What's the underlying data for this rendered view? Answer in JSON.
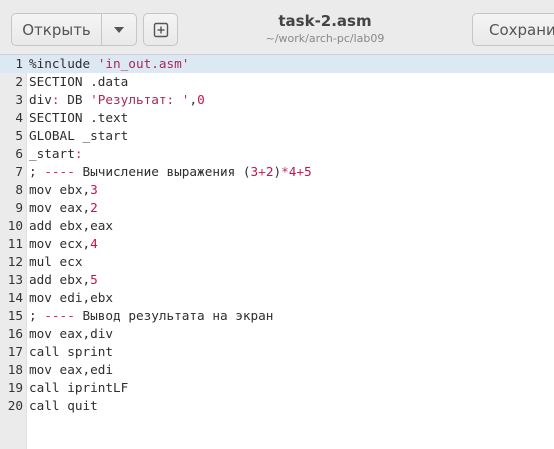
{
  "header": {
    "open_label": "Открыть",
    "title": "task-2.asm",
    "subtitle": "~/work/arch-pc/lab09",
    "save_label": "Сохранить"
  },
  "icons": {
    "open_menu": "chevron-down-icon",
    "new_tab": "new-document-icon"
  },
  "colors": {
    "string": "#a52a54",
    "number": "#c0174a",
    "operator": "#d2245a",
    "current_line": "#dde8f5"
  },
  "editor": {
    "current_line": 1,
    "lines": [
      [
        {
          "t": "%include ",
          "c": "kw"
        },
        {
          "t": "'in_out.asm'",
          "c": "str"
        }
      ],
      [
        {
          "t": "SECTION .data",
          "c": "kw"
        }
      ],
      [
        {
          "t": "div",
          "c": "kw"
        },
        {
          "t": ":",
          "c": "red"
        },
        {
          "t": " DB ",
          "c": "kw"
        },
        {
          "t": "'Результат: '",
          "c": "str"
        },
        {
          "t": ",",
          "c": "kw"
        },
        {
          "t": "0",
          "c": "num"
        }
      ],
      [
        {
          "t": "SECTION .text",
          "c": "kw"
        }
      ],
      [
        {
          "t": "GLOBAL _start",
          "c": "kw"
        }
      ],
      [
        {
          "t": "_start",
          "c": "kw"
        },
        {
          "t": ":",
          "c": "red"
        }
      ],
      [
        {
          "t": "; ",
          "c": "kw"
        },
        {
          "t": "----",
          "c": "red"
        },
        {
          "t": " Вычисление выражения (",
          "c": "kw"
        },
        {
          "t": "3",
          "c": "num"
        },
        {
          "t": "+",
          "c": "red"
        },
        {
          "t": "2",
          "c": "num"
        },
        {
          "t": ")",
          "c": "kw"
        },
        {
          "t": "*",
          "c": "red"
        },
        {
          "t": "4",
          "c": "num"
        },
        {
          "t": "+",
          "c": "red"
        },
        {
          "t": "5",
          "c": "num"
        }
      ],
      [
        {
          "t": "mov ebx,",
          "c": "kw"
        },
        {
          "t": "3",
          "c": "num"
        }
      ],
      [
        {
          "t": "mov eax,",
          "c": "kw"
        },
        {
          "t": "2",
          "c": "num"
        }
      ],
      [
        {
          "t": "add ebx,eax",
          "c": "kw"
        }
      ],
      [
        {
          "t": "mov ecx,",
          "c": "kw"
        },
        {
          "t": "4",
          "c": "num"
        }
      ],
      [
        {
          "t": "mul ecx",
          "c": "kw"
        }
      ],
      [
        {
          "t": "add ebx,",
          "c": "kw"
        },
        {
          "t": "5",
          "c": "num"
        }
      ],
      [
        {
          "t": "mov edi,ebx",
          "c": "kw"
        }
      ],
      [
        {
          "t": "; ",
          "c": "kw"
        },
        {
          "t": "----",
          "c": "red"
        },
        {
          "t": " Вывод результата на экран",
          "c": "kw"
        }
      ],
      [
        {
          "t": "mov eax,div",
          "c": "kw"
        }
      ],
      [
        {
          "t": "call sprint",
          "c": "kw"
        }
      ],
      [
        {
          "t": "mov eax,edi",
          "c": "kw"
        }
      ],
      [
        {
          "t": "call iprintLF",
          "c": "kw"
        }
      ],
      [
        {
          "t": "call quit",
          "c": "kw"
        }
      ]
    ]
  }
}
